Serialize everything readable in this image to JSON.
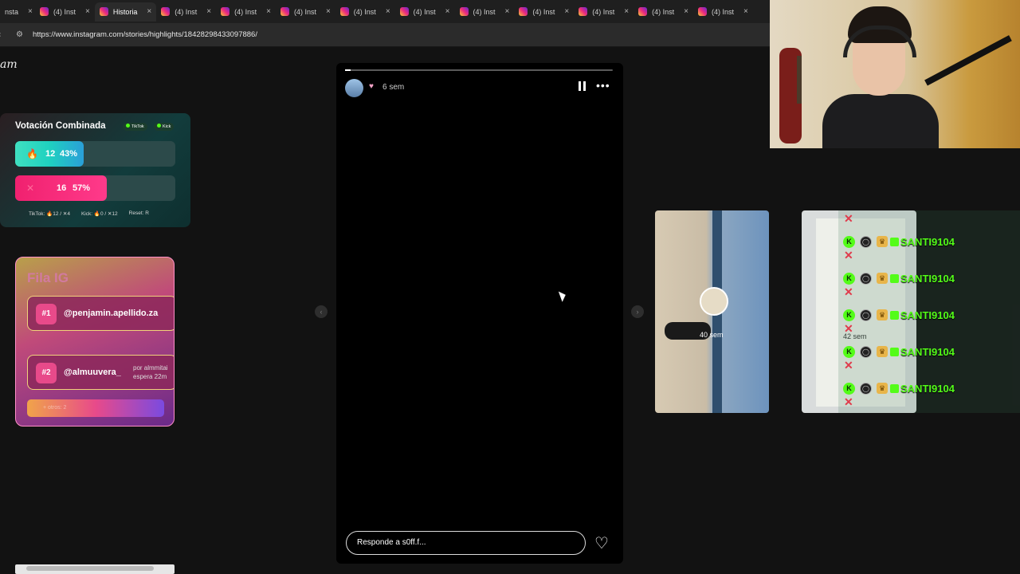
{
  "browser": {
    "tabs": [
      {
        "label": "nsta",
        "close": "×",
        "variant": "cut"
      },
      {
        "label": "(4) Inst",
        "close": "×",
        "variant": ""
      },
      {
        "label": "Historia",
        "close": "×",
        "variant": "active"
      },
      {
        "label": "(4) Inst",
        "close": "×",
        "variant": ""
      },
      {
        "label": "(4) Inst",
        "close": "×",
        "variant": ""
      },
      {
        "label": "(4) Inst",
        "close": "×",
        "variant": ""
      },
      {
        "label": "(4) Inst",
        "close": "×",
        "variant": ""
      },
      {
        "label": "(4) Inst",
        "close": "×",
        "variant": ""
      },
      {
        "label": "(4) Inst",
        "close": "×",
        "variant": ""
      },
      {
        "label": "(4) Inst",
        "close": "×",
        "variant": ""
      },
      {
        "label": "(4) Inst",
        "close": "×",
        "variant": ""
      },
      {
        "label": "(4) Inst",
        "close": "×",
        "variant": ""
      },
      {
        "label": "(4) Inst",
        "close": "×",
        "variant": ""
      }
    ],
    "url": "https://www.instagram.com/stories/highlights/18428298433097886/"
  },
  "instagram": {
    "logo_fragment": "am"
  },
  "story": {
    "time": "6 sem",
    "progress_fraction": 0.02,
    "reply_placeholder": "Responde a s0ff.f...",
    "heart_glyph": "♥",
    "more_glyph": "•••",
    "like_glyph": "♡",
    "prev_glyph": "‹",
    "next_glyph": "›"
  },
  "thumbnails": [
    {
      "time": "40 sem"
    },
    {
      "time": "42 sem"
    }
  ],
  "chat": {
    "rows": [
      {
        "name": "SANTI9104"
      },
      {
        "name": "SANTI9104"
      },
      {
        "name": "SANTI9104"
      },
      {
        "name": "SANTI9104"
      },
      {
        "name": "SANTI9104"
      }
    ],
    "x_glyph": "✕"
  },
  "vote": {
    "title": "Votación Combinada",
    "pills": [
      "TikTok",
      "Kick"
    ],
    "options": [
      {
        "icon": "flame-icon",
        "count": "12",
        "percent": "43%",
        "fraction": 0.43,
        "color": "#1fd1c0"
      },
      {
        "icon": "cross-icon",
        "count": "16",
        "percent": "57%",
        "fraction": 0.57,
        "color": "#f0216f"
      }
    ],
    "footer": {
      "tiktok": "TikTok: 🔥12 / ✕4",
      "kick": "Kick: 🔥0 / ✕12",
      "reset": "Reset: R"
    }
  },
  "fila": {
    "title": "Fila IG",
    "items": [
      {
        "rank": "#1",
        "user": "@penjamin.apellido.za",
        "meta1": "",
        "meta2": ""
      },
      {
        "rank": "#2",
        "user": "@almuuvera_",
        "meta1": "por almmitai",
        "meta2": "espera 22m"
      }
    ],
    "more": "+ otros: 2"
  }
}
